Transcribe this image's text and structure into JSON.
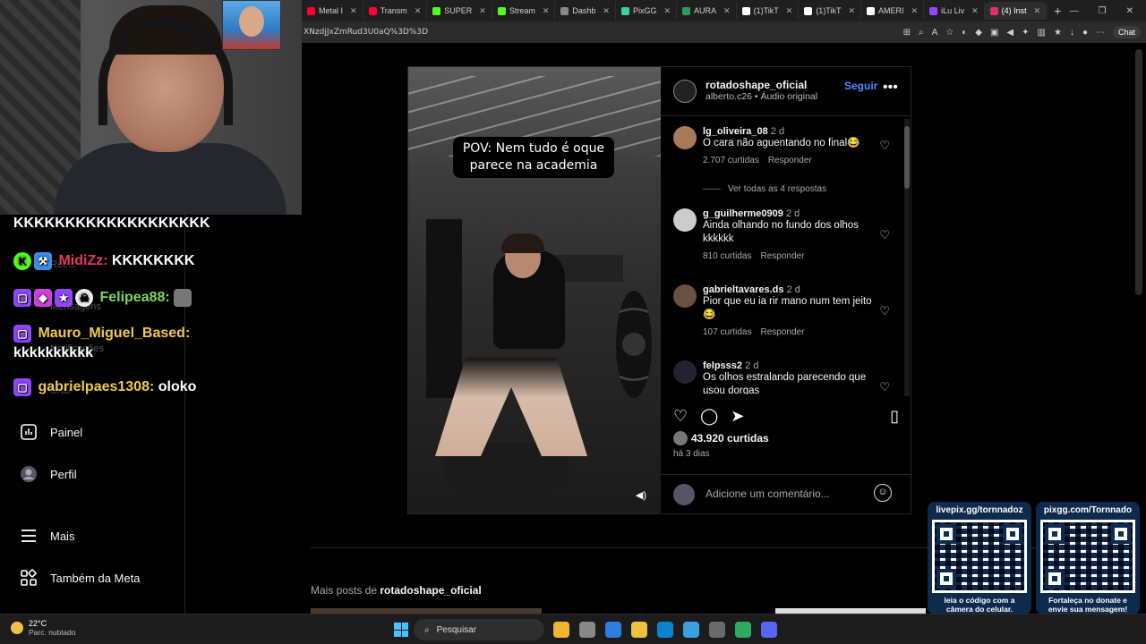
{
  "browser": {
    "tabs": [
      {
        "label": "Metal I",
        "color": "#ff0033"
      },
      {
        "label": "Transm",
        "color": "#ff0033"
      },
      {
        "label": "SUPER",
        "color": "#53fc18"
      },
      {
        "label": "Stream",
        "color": "#53fc18"
      },
      {
        "label": "Dashb",
        "color": "#888888"
      },
      {
        "label": "PixGG",
        "color": "#3fd0a0"
      },
      {
        "label": "AURA",
        "color": "#2a9d5a"
      },
      {
        "label": "(1)TikT",
        "color": "#ffffff"
      },
      {
        "label": "(1)TikT",
        "color": "#ffffff"
      },
      {
        "label": "AMERI",
        "color": "#ffffff"
      },
      {
        "label": "iLu Liv",
        "color": "#9146ff"
      },
      {
        "label": "(4) Inst",
        "color": "#e1306c"
      }
    ],
    "url": "XNzdjJxZmRud3U0aQ%3D%3D",
    "chat_label": "Chat"
  },
  "sidebar": {
    "ghost_items": [
      "Reels",
      "Mensagens",
      "Notificações",
      "Criar"
    ],
    "nav": [
      {
        "label": "Painel",
        "icon": "dashboard-icon"
      },
      {
        "label": "Perfil",
        "icon": "profile-avatar-icon"
      },
      {
        "label": "Mais",
        "icon": "menu-icon"
      },
      {
        "label": "Também da Meta",
        "icon": "meta-apps-icon"
      }
    ]
  },
  "chat_overlay": [
    {
      "user": "",
      "message": "KKKKKKKKKKKKKKKKKKK",
      "user_color": "#ffffff"
    },
    {
      "user": "MidiZz:",
      "message": "KKKKKKKK",
      "user_color": "#e8375e"
    },
    {
      "user": "Felipea88:",
      "message": "",
      "user_color": "#7fd85a"
    },
    {
      "user": "Mauro_Miguel_Based:",
      "message": "kkkkkkkkkk",
      "user_color": "#f0c850"
    },
    {
      "user": "gabrielpaes1308:",
      "message": "oloko",
      "user_color": "#f0c850"
    }
  ],
  "post": {
    "video_caption": "POV: Nem tudo é oque parece na academia",
    "author": "rotadoshape_oficial",
    "subtitle": "alberto.c26 • Áudio original",
    "follow_label": "Seguir",
    "comments": [
      {
        "user": "lg_oliveira_08",
        "time": "2 d",
        "text": "O cara não aguentando no final😂",
        "likes": "2.707 curtidas",
        "reply": "Responder",
        "avatar_color": "#a87a5a"
      },
      {
        "user": "g_guilherme0909",
        "time": "2 d",
        "text": "Ainda olhando no fundo dos olhos kkkkkk",
        "likes": "810 curtidas",
        "reply": "Responder",
        "avatar_color": "#cccccc"
      },
      {
        "user": "gabrieltavares.ds",
        "time": "2 d",
        "text": "Pior que eu ia rir mano num tem jeito 😂",
        "likes": "107 curtidas",
        "reply": "Responder",
        "avatar_color": "#6a5040"
      },
      {
        "user": "felpsss2",
        "time": "2 d",
        "text": "Os olhos estralando parecendo que usou dorgas",
        "likes": "",
        "reply": "",
        "avatar_color": "#222233"
      }
    ],
    "view_replies": "Ver todas as 4 respostas",
    "total_likes": "43.920 curtidas",
    "posted": "há 3 dias",
    "comment_placeholder": "Adicione um comentário..."
  },
  "more_posts": {
    "prefix": "Mais posts de",
    "user": "rotadoshape_oficial"
  },
  "qr": [
    {
      "title": "livepix.gg/tornnadoz",
      "caption": "leia o código com a câmera do celular."
    },
    {
      "title": "pixgg.com/Tornnado",
      "caption": "Fortaleça no donate e envie sua mensagem!"
    }
  ],
  "taskbar": {
    "temp": "22°C",
    "weather": "Parc. nublado",
    "search_placeholder": "Pesquisar",
    "app_colors": [
      "#f2b530",
      "#888888",
      "#2f7de0",
      "#f0c040",
      "#0a84d0",
      "#3aa0e0",
      "#6a6a6a",
      "#2faa60",
      "#5865f2"
    ]
  }
}
